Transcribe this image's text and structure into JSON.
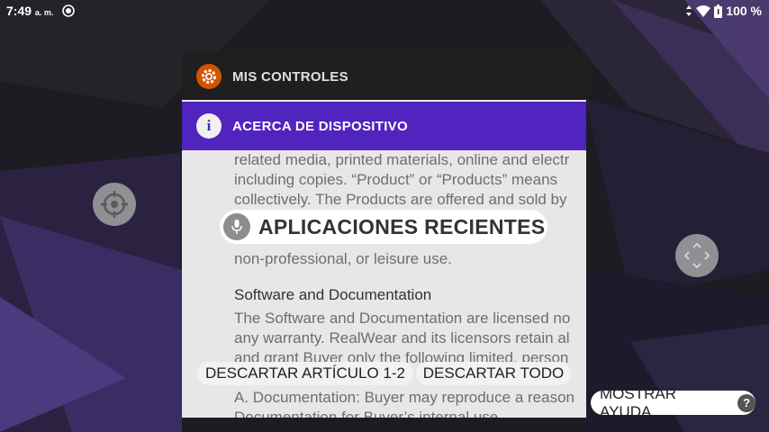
{
  "status_bar": {
    "time": "7:49",
    "ampm": "a. m.",
    "battery_percent": "100 %"
  },
  "panel": {
    "header_label": "MIS CONTROLES",
    "tab_label": "ACERCA DE DISPOSITIVO",
    "tab_icon_glyph": "i",
    "document_lines": [
      "related media, printed materials, online and electr",
      "including copies. “Product” or “Products” means",
      "collectively. The Products are offered and sold by",
      "",
      "",
      "non-professional, or leisure use."
    ],
    "section_heading": "Software and Documentation",
    "section_lines": [
      "The Software and Documentation are licensed no",
      "any warranty. RealWear and its licensors retain al",
      "and grant Buyer only the following limited, person",
      "",
      "A. Documentation: Buyer may reproduce a reason",
      "Documentation for Buyer’s internal use."
    ]
  },
  "voice_overlay": {
    "recent_apps_label": "APLICACIONES RECIENTES"
  },
  "actions": {
    "dismiss_item_label": "DESCARTAR ARTÍCULO 1-2",
    "dismiss_all_label": "DESCARTAR TODO",
    "show_help_label": "MOSTRAR AYUDA",
    "help_glyph": "?"
  },
  "icons": {
    "cast": "cast-icon",
    "wifi": "wifi-icon",
    "battery": "battery-icon",
    "gear": "gear-icon",
    "info": "info-icon",
    "mic": "mic-icon",
    "crosshair": "crosshair-icon",
    "pan": "pan-arrows-icon"
  },
  "colors": {
    "header_bg": "#1f1f1f",
    "tab_bg": "#5123bf",
    "gear_accent": "#d35400",
    "panel_bg": "#e7e7e7"
  }
}
